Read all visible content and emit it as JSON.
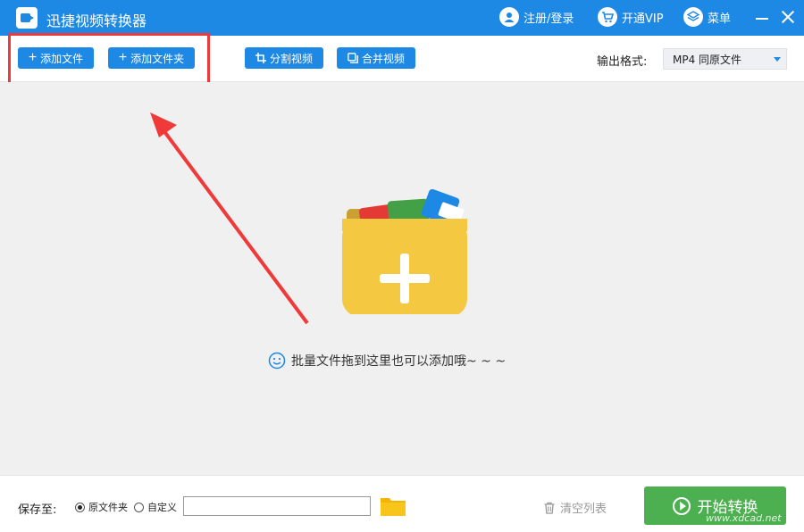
{
  "window": {
    "title": "迅捷视频转换器",
    "login_label": "注册/登录",
    "vip_label": "开通VIP",
    "menu_label": "菜单"
  },
  "toolbar": {
    "add_file": "添加文件",
    "add_folder": "添加文件夹",
    "split_video": "分割视频",
    "merge_video": "合并视频",
    "output_format_label": "输出格式:",
    "output_format_value": "MP4  同原文件"
  },
  "drop": {
    "hint": "批量文件拖到这里也可以添加哦~ ~ ~"
  },
  "footer": {
    "save_to": "保存至:",
    "option_original": "原文件夹",
    "option_custom": "自定义",
    "path_value": "",
    "clear_list": "清空列表",
    "start": "开始转换",
    "watermark": "www.xdcad.net"
  },
  "colors": {
    "brand": "#1e88e5",
    "start": "#4caf50",
    "highlight": "#f03a3a",
    "folder": "#f5c842"
  }
}
